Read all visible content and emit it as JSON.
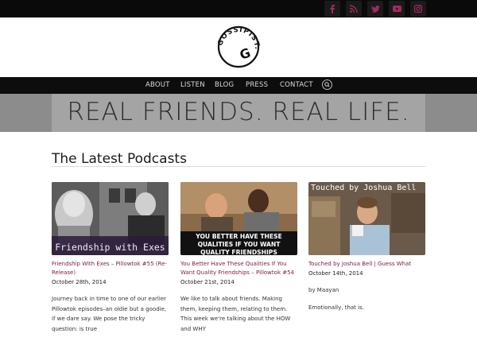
{
  "social": [
    "facebook-icon",
    "rss-icon",
    "twitter-icon",
    "youtube-icon",
    "instagram-icon"
  ],
  "brand": {
    "logo_text": "GOSSIPIST."
  },
  "nav": {
    "items": [
      "ABOUT",
      "LISTEN",
      "BLOG",
      "PRESS",
      "CONTACT"
    ]
  },
  "banner": {
    "text": "REAL FRIENDS. REAL LIFE."
  },
  "section": {
    "title": "The Latest Podcasts"
  },
  "podcasts": [
    {
      "thumb_caption": "Friendship with Exes",
      "title": "Friendship With Exes – Pillowtok #55 (Re-Release)",
      "date": "October 28th, 2014",
      "excerpt": [
        "Journey back in time to one of our earlier Pillowtok episodes–an oldie but a goodie, if we dare say. We pose the tricky question:  is true"
      ]
    },
    {
      "thumb_caption": "You Better Have These Qualities If You Want Quality Friendships",
      "title": "You Better Have These Qualities If You Want Quality Friendships – Pillowtok #54",
      "date": "October 21st, 2014",
      "excerpt": [
        "We like to talk about friends. Making them, keeping them, relating to them. This week we're talking about the HOW and WHY"
      ]
    },
    {
      "thumb_caption": "Touched by Joshua Bell",
      "title": "Touched by Joshua Bell | Guess What",
      "date": "October 14th, 2014",
      "excerpt": [
        "by Maayan",
        "Emotionally, that is."
      ]
    }
  ],
  "colors": {
    "accent": "#7a2148",
    "topbar": "#0a0a0a",
    "social_icon": "#a02a5e"
  }
}
